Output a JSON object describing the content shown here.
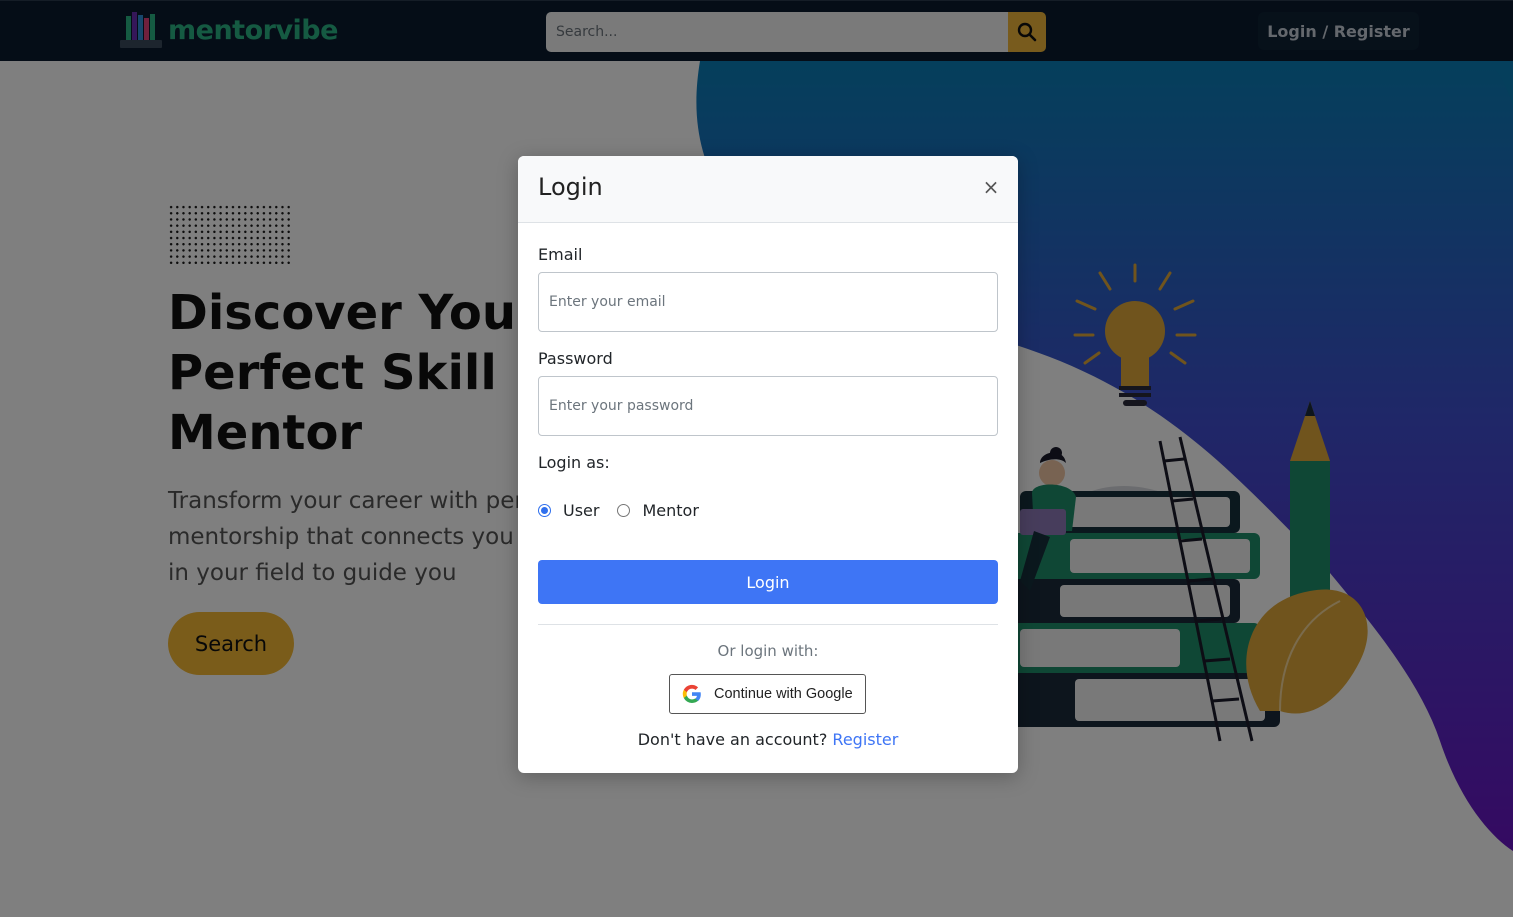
{
  "navbar": {
    "logo_text": "mentorvibe",
    "search_placeholder": "Search...",
    "login_register": "Login / Register"
  },
  "hero": {
    "title": "Discover Your Perfect Skill Mentor",
    "subtitle": "Transform your career with personalized mentorship that connects you with experts in your field to guide you",
    "search_button": "Search"
  },
  "modal": {
    "title": "Login",
    "close": "×",
    "email_label": "Email",
    "email_placeholder": "Enter your email",
    "password_label": "Password",
    "password_placeholder": "Enter your password",
    "login_as_label": "Login as:",
    "role_options": [
      "User",
      "Mentor"
    ],
    "selected_role": "User",
    "login_button": "Login",
    "or_login_with": "Or login with:",
    "google_button": "Continue with Google",
    "no_account_text": "Don't have an account?",
    "register_link": "Register"
  },
  "colors": {
    "navbar_bg": "#0b1a2e",
    "brand_green": "#2bb585",
    "accent_gold": "#f5b935",
    "primary_blue": "#3e75f5",
    "blob_top": "#0a7fb8",
    "blob_bottom": "#6a14c4"
  },
  "icons": [
    "search-icon",
    "close-icon",
    "google-icon",
    "logo-books-icon"
  ]
}
